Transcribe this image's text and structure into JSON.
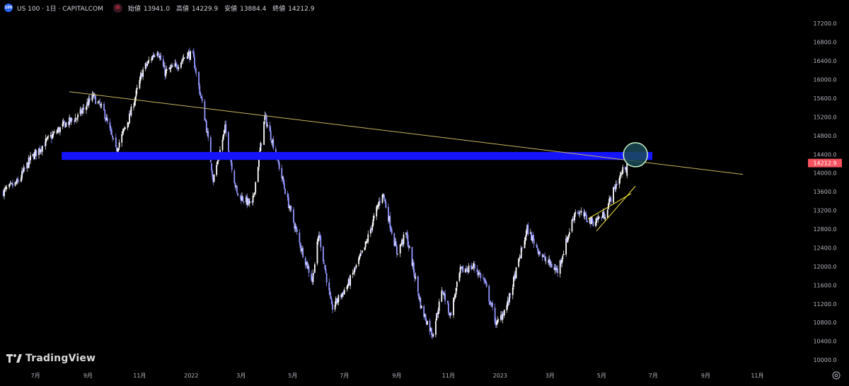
{
  "header": {
    "symbol_badge": "100",
    "symbol_title": "US 100 · 1日 · CAPITALCOM",
    "flag_icon": "currency-flag-icon",
    "ohlc": [
      {
        "key": "始値",
        "value": "13941.0"
      },
      {
        "key": "高値",
        "value": "14229.9"
      },
      {
        "key": "安値",
        "value": "13884.4"
      },
      {
        "key": "終値",
        "value": "14212.9"
      }
    ]
  },
  "price_badge": {
    "label": "14212.9",
    "color": "#f7525f"
  },
  "watermark": {
    "text": "TradingView",
    "icon": "tradingview-logo-icon"
  },
  "settings_icon": "settings-gear-icon",
  "colors": {
    "background": "#000000",
    "candle_up": "#ffffff",
    "candle_down": "#9598ff",
    "support_zone": "#1414ff",
    "trendline": "#c8b560",
    "wedge_lines": "#ffeb3b",
    "target_circle_fill": "#1b4a57",
    "target_circle_stroke": "#c9f5c5"
  },
  "chart_data": {
    "type": "candlestick",
    "symbol": "US 100",
    "interval": "1日",
    "y_axis": {
      "ticks": [
        10000,
        10400,
        10800,
        11200,
        11600,
        12000,
        12400,
        12800,
        13200,
        13600,
        14000,
        14400,
        14800,
        15200,
        15600,
        16000,
        16400,
        16800,
        17200
      ],
      "tick_labels": [
        "10000.0",
        "10400.0",
        "10800.0",
        "11200.0",
        "11600.0",
        "12000.0",
        "12400.0",
        "12800.0",
        "13200.0",
        "13600.0",
        "14000.0",
        "14400.0",
        "14800.0",
        "15200.0",
        "15600.0",
        "16000.0",
        "16400.0",
        "16800.0",
        "17200.0"
      ],
      "range": [
        9880,
        17430
      ]
    },
    "x_axis": {
      "tick_labels": [
        "7月",
        "9月",
        "11月",
        "2022",
        "3月",
        "5月",
        "7月",
        "9月",
        "11月",
        "2023",
        "3月",
        "5月",
        "7月",
        "9月",
        "11月"
      ],
      "tick_dates": [
        "2021-07-01",
        "2021-09-01",
        "2021-11-01",
        "2022-01-01",
        "2022-03-01",
        "2022-05-01",
        "2022-07-01",
        "2022-09-01",
        "2022-11-01",
        "2023-01-01",
        "2023-03-01",
        "2023-05-01",
        "2023-07-01",
        "2023-09-01",
        "2023-11-01"
      ],
      "range": [
        "2021-05-20",
        "2023-12-25"
      ]
    },
    "price_path": [
      [
        "2021-05-24",
        13600
      ],
      [
        "2021-06-10",
        13800
      ],
      [
        "2021-06-25",
        14300
      ],
      [
        "2021-07-15",
        14700
      ],
      [
        "2021-08-05",
        15050
      ],
      [
        "2021-08-20",
        15200
      ],
      [
        "2021-09-07",
        15650
      ],
      [
        "2021-09-20",
        15300
      ],
      [
        "2021-10-04",
        14480
      ],
      [
        "2021-10-20",
        15200
      ],
      [
        "2021-11-05",
        16200
      ],
      [
        "2021-11-22",
        16650
      ],
      [
        "2021-12-01",
        16150
      ],
      [
        "2021-12-15",
        16300
      ],
      [
        "2021-12-27",
        16550
      ],
      [
        "2022-01-03",
        16500
      ],
      [
        "2022-01-10",
        15850
      ],
      [
        "2022-01-18",
        15100
      ],
      [
        "2022-01-27",
        13850
      ],
      [
        "2022-02-10",
        14950
      ],
      [
        "2022-02-24",
        13550
      ],
      [
        "2022-03-14",
        13300
      ],
      [
        "2022-03-29",
        15200
      ],
      [
        "2022-04-10",
        14500
      ],
      [
        "2022-04-25",
        13400
      ],
      [
        "2022-05-09",
        12500
      ],
      [
        "2022-05-24",
        11700
      ],
      [
        "2022-06-01",
        12700
      ],
      [
        "2022-06-16",
        11100
      ],
      [
        "2022-07-05",
        11600
      ],
      [
        "2022-07-25",
        12400
      ],
      [
        "2022-08-15",
        13600
      ],
      [
        "2022-09-01",
        12300
      ],
      [
        "2022-09-12",
        12700
      ],
      [
        "2022-09-30",
        11100
      ],
      [
        "2022-10-13",
        10550
      ],
      [
        "2022-10-25",
        11500
      ],
      [
        "2022-11-03",
        10950
      ],
      [
        "2022-11-15",
        11900
      ],
      [
        "2022-12-01",
        12000
      ],
      [
        "2022-12-13",
        11700
      ],
      [
        "2022-12-28",
        10750
      ],
      [
        "2023-01-10",
        11200
      ],
      [
        "2023-02-02",
        12800
      ],
      [
        "2023-02-20",
        12200
      ],
      [
        "2023-03-10",
        11900
      ],
      [
        "2023-03-31",
        13200
      ],
      [
        "2023-04-20",
        12950
      ],
      [
        "2023-05-04",
        13100
      ],
      [
        "2023-05-19",
        13800
      ],
      [
        "2023-05-31",
        14212.9
      ]
    ],
    "last_price": 14212.9,
    "last_ohlc": {
      "open": 13941.0,
      "high": 14229.9,
      "low": 13884.4,
      "close": 14212.9
    },
    "drawings": {
      "support_zone": {
        "low": 14280,
        "high": 14450,
        "from": "2021-08-01",
        "to": "2023-06-30"
      },
      "descending_trendline": {
        "from": [
          "2021-08-10",
          15740
        ],
        "to": [
          "2023-10-15",
          13970
        ]
      },
      "rising_wedge": {
        "upper": {
          "from": [
            "2023-04-15",
            13020
          ],
          "to": [
            "2023-06-05",
            13560
          ]
        },
        "lower": {
          "from": [
            "2023-04-25",
            12760
          ],
          "to": [
            "2023-06-10",
            13720
          ]
        }
      },
      "target_circle": {
        "date": "2023-06-10",
        "price": 14390
      }
    }
  }
}
